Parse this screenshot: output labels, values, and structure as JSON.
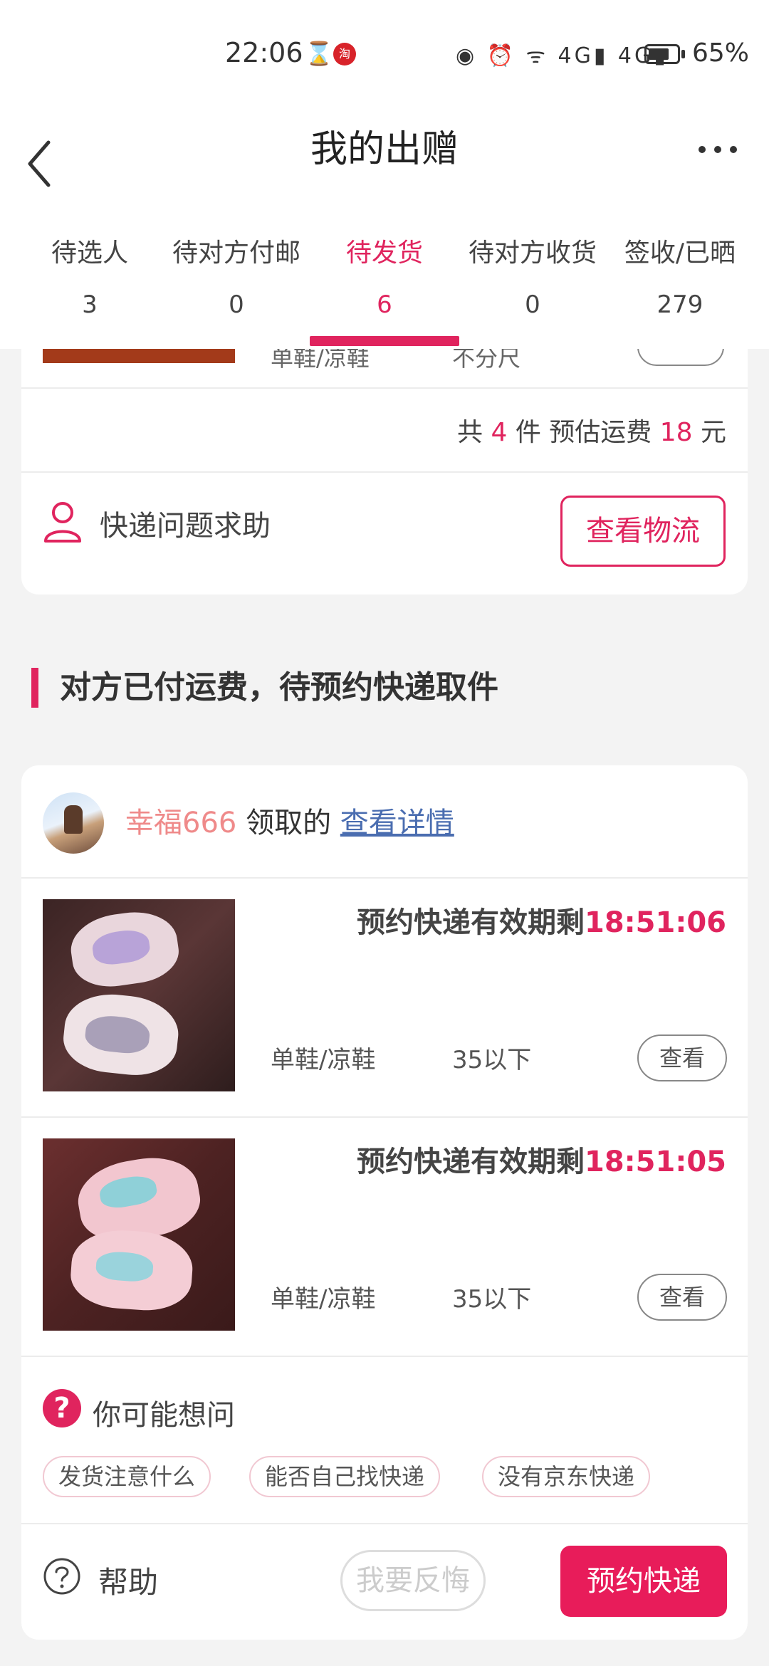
{
  "status_bar": {
    "time": "22:06",
    "battery": "65%",
    "indicators": "◉ ⏰ ᯤ 4G▮ 4G▮"
  },
  "header": {
    "title": "我的出赠"
  },
  "tabs": [
    {
      "label": "待选人",
      "count": "3"
    },
    {
      "label": "待对方付邮",
      "count": "0"
    },
    {
      "label": "待发货",
      "count": "6",
      "active": true
    },
    {
      "label": "待对方收货",
      "count": "0"
    },
    {
      "label": "签收/已晒",
      "count": "279"
    }
  ],
  "top_card": {
    "partial_category": "单鞋/凉鞋",
    "partial_size": "不分尺",
    "partial_button": "查看",
    "total_prefix": "共",
    "total_count": "4",
    "total_mid": "件 预估运费",
    "total_fee": "18",
    "total_suffix": "元",
    "help_label": "快递问题求助",
    "logistics_button": "查看物流"
  },
  "section": {
    "heading": "对方已付运费，待预约快递取件"
  },
  "order": {
    "recipient_name": "幸福666",
    "received_text": "领取的",
    "detail_link": "查看详情",
    "items": [
      {
        "countdown_label": "预约快递有效期剩",
        "countdown": "18:51:06",
        "category": "单鞋/凉鞋",
        "size": "35以下",
        "button": "查看"
      },
      {
        "countdown_label": "预约快递有效期剩",
        "countdown": "18:51:05",
        "category": "单鞋/凉鞋",
        "size": "35以下",
        "button": "查看"
      }
    ],
    "faq_title": "你可能想问",
    "faq_chips": [
      "发货注意什么",
      "能否自己找快递",
      "没有京东快递"
    ],
    "help_label": "帮助",
    "regret_button": "我要反悔",
    "primary_button": "预约快递"
  },
  "colors": {
    "accent": "#e0245e",
    "primary_button": "#e81c5a",
    "link": "#4a6db0",
    "background": "#f3f3f3"
  }
}
